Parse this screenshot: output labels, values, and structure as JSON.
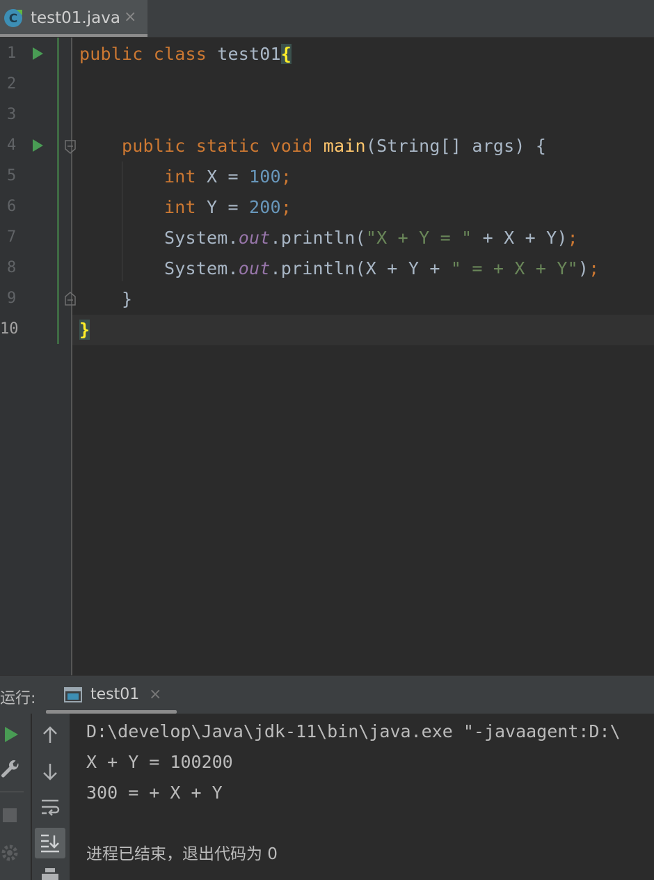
{
  "editor_tab": {
    "filename": "test01.java",
    "close": "×"
  },
  "editor": {
    "line_numbers": [
      "1",
      "2",
      "3",
      "4",
      "5",
      "6",
      "7",
      "8",
      "9",
      "10"
    ],
    "lines": [
      [
        [
          "kw",
          "public class "
        ],
        [
          "plain",
          "test01"
        ],
        [
          "brace",
          "{"
        ]
      ],
      [],
      [],
      [
        [
          "plain",
          "    "
        ],
        [
          "kw",
          "public static void "
        ],
        [
          "fn",
          "main"
        ],
        [
          "plain",
          "(String[] args) {"
        ]
      ],
      [
        [
          "plain",
          "        "
        ],
        [
          "kw",
          "int "
        ],
        [
          "plain",
          "X = "
        ],
        [
          "num",
          "100"
        ],
        [
          "kw",
          ";"
        ]
      ],
      [
        [
          "plain",
          "        "
        ],
        [
          "kw",
          "int "
        ],
        [
          "plain",
          "Y = "
        ],
        [
          "num",
          "200"
        ],
        [
          "kw",
          ";"
        ]
      ],
      [
        [
          "plain",
          "        System."
        ],
        [
          "fld",
          "out"
        ],
        [
          "plain",
          ".println("
        ],
        [
          "str",
          "\"X + Y = \""
        ],
        [
          "plain",
          " + X + Y)"
        ],
        [
          "kw",
          ";"
        ]
      ],
      [
        [
          "plain",
          "        System."
        ],
        [
          "fld",
          "out"
        ],
        [
          "plain",
          ".println(X + Y + "
        ],
        [
          "str",
          "\" = + X + Y\""
        ],
        [
          "plain",
          ")"
        ],
        [
          "kw",
          ";"
        ]
      ],
      [
        [
          "plain",
          "    }"
        ]
      ],
      [
        [
          "brace",
          "}"
        ]
      ]
    ]
  },
  "run_panel": {
    "title": "运行:",
    "tab_label": "test01",
    "tab_close": "×",
    "console_lines": [
      "D:\\develop\\Java\\jdk-11\\bin\\java.exe \"-javaagent:D:\\",
      "X + Y = 100200",
      "300 = + X + Y",
      "",
      "进程已结束，退出代码为 0"
    ]
  },
  "colors": {
    "keyword": "#cc7832",
    "function": "#ffc66d",
    "number": "#6897bb",
    "string": "#6a8759",
    "field": "#9876aa",
    "plain": "#a9b7c6",
    "run_green": "#499c54"
  },
  "icons": [
    "java-class-icon",
    "run-gutter-icon",
    "fold-icon",
    "console-tab-icon",
    "rerun-icon",
    "wrench-icon",
    "stop-icon",
    "settings-icon",
    "up-arrow-icon",
    "down-arrow-icon",
    "soft-wrap-icon",
    "scroll-to-end-icon",
    "print-icon"
  ]
}
